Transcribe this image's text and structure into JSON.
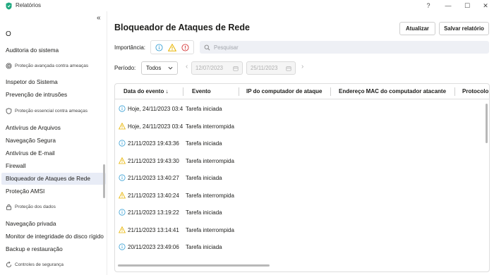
{
  "window": {
    "title": "Relatórios",
    "help_label": "?",
    "minimize_label": "—",
    "maximize_label": "☐",
    "close_label": "✕"
  },
  "sidebar": {
    "collapse_label": "«",
    "top_circle_label": "O",
    "sections": [
      {
        "label": "Proteção avançada contra ameaças",
        "icon": "fingerprint-icon"
      },
      {
        "label": "Proteção essencial contra ameaças",
        "icon": "shield-icon"
      },
      {
        "label": "Proteção dos dados",
        "icon": "lock-icon"
      },
      {
        "label": "Controles de segurança",
        "icon": "refresh-icon"
      }
    ],
    "items": [
      {
        "label": "Auditoria do sistema"
      },
      {
        "label": "Inspetor do Sistema"
      },
      {
        "label": "Prevenção de intrusões"
      },
      {
        "label": "Antivírus de Arquivos"
      },
      {
        "label": "Navegação Segura"
      },
      {
        "label": "Antivírus de E-mail"
      },
      {
        "label": "Firewall"
      },
      {
        "label": "Bloqueador de Ataques de Rede"
      },
      {
        "label": "Proteção AMSI"
      },
      {
        "label": "Navegação privada"
      },
      {
        "label": "Monitor de integridade do disco rígido"
      },
      {
        "label": "Backup e restauração"
      }
    ]
  },
  "main": {
    "title": "Bloqueador de Ataques de Rede",
    "update_button": "Atualizar",
    "save_button": "Salvar relatório",
    "importance_label": "Importância:",
    "search_placeholder": "Pesquisar",
    "period_label": "Período:",
    "period_value": "Todos",
    "date_from": "12/07/2023",
    "date_to": "25/11/2023",
    "colors": {
      "info": "#3fa3d6",
      "warning": "#e8b400",
      "error": "#d63c3c",
      "active_bg": "#e8ecf6"
    }
  },
  "table": {
    "columns": [
      "Data do evento ↓",
      "Evento",
      "IP do computador de ataque",
      "Endereço MAC do computador atacante",
      "Protocolo"
    ],
    "rows": [
      {
        "severity": "info",
        "date": "Hoje, 24/11/2023 03:4",
        "event": "Tarefa iniciada"
      },
      {
        "severity": "warning",
        "date": "Hoje, 24/11/2023 03:4",
        "event": "Tarefa interrompida"
      },
      {
        "severity": "info",
        "date": "21/11/2023 19:43:36",
        "event": "Tarefa iniciada"
      },
      {
        "severity": "warning",
        "date": "21/11/2023 19:43:30",
        "event": "Tarefa interrompida"
      },
      {
        "severity": "info",
        "date": "21/11/2023 13:40:27",
        "event": "Tarefa iniciada"
      },
      {
        "severity": "warning",
        "date": "21/11/2023 13:40:24",
        "event": "Tarefa interrompida"
      },
      {
        "severity": "info",
        "date": "21/11/2023 13:19:22",
        "event": "Tarefa iniciada"
      },
      {
        "severity": "warning",
        "date": "21/11/2023 13:14:41",
        "event": "Tarefa interrompida"
      },
      {
        "severity": "info",
        "date": "20/11/2023 23:49:06",
        "event": "Tarefa iniciada"
      }
    ]
  }
}
